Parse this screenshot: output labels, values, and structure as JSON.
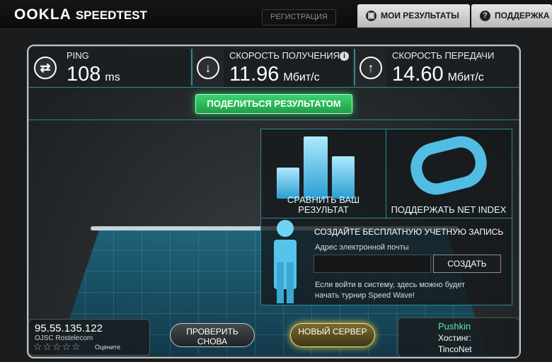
{
  "header": {
    "logo_main": "OOKLA",
    "logo_sub": "SPEEDTEST",
    "register_label": "РЕГИСТРАЦИЯ",
    "results_label": "МОИ РЕЗУЛЬТАТЫ",
    "support_label": "ПОДДЕРЖКА"
  },
  "metrics": {
    "ping": {
      "label": "PING",
      "value": "108",
      "unit": "ms"
    },
    "download": {
      "label": "СКОРОСТЬ ПОЛУЧЕНИЯ",
      "value": "11.96",
      "unit": "Мбит/с"
    },
    "upload": {
      "label": "СКОРОСТЬ ПЕРЕДАЧИ",
      "value": "14.60",
      "unit": "Мбит/с"
    }
  },
  "share_label": "ПОДЕЛИТЬСЯ РЕЗУЛЬТАТОМ",
  "panel": {
    "compare_label": "СРАВНИТЬ ВАШ РЕЗУЛЬТАТ",
    "netindex_label": "ПОДДЕРЖАТЬ NET INDEX",
    "signup_title": "СОЗДАЙТЕ БЕСПЛАТНУЮ УЧЕТНУЮ ЗАПИСЬ",
    "email_label": "Адрес электронной почты",
    "email_value": "",
    "create_label": "СОЗДАТЬ",
    "note": "Если войти в систему, здесь можно будет начать турнир Speed Wave!"
  },
  "client": {
    "ip": "95.55.135.122",
    "isp": "OJSC Rostelecom",
    "rate_label": "Оцените",
    "stars": "☆☆☆☆☆"
  },
  "buttons": {
    "retest": "ПРОВЕРИТЬ СНОВА",
    "new_server": "НОВЫЙ СЕРВЕР"
  },
  "server": {
    "city": "Pushkin",
    "host_label": "Хостинг:",
    "host_name": "TincoNet"
  },
  "colors": {
    "accent_green": "#27c461",
    "accent_cyan": "#2d8a96",
    "gold": "#e7c64b"
  }
}
